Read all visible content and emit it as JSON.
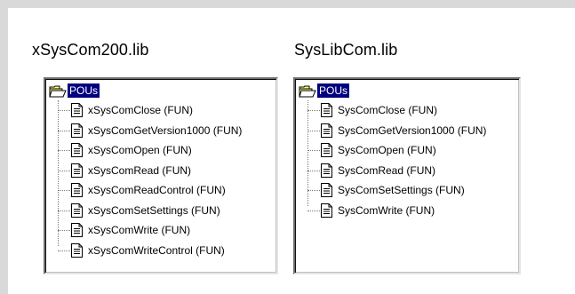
{
  "left_library": {
    "title": "xSysCom200.lib",
    "root_label": "POUs",
    "items": [
      "xSysComClose (FUN)",
      "xSysComGetVersion1000 (FUN)",
      "xSysComOpen (FUN)",
      "xSysComRead (FUN)",
      "xSysComReadControl (FUN)",
      "xSysComSetSettings (FUN)",
      "xSysComWrite (FUN)",
      "xSysComWriteControl (FUN)"
    ]
  },
  "right_library": {
    "title": "SysLibCom.lib",
    "root_label": "POUs",
    "items": [
      "SysComClose (FUN)",
      "SysComGetVersion1000 (FUN)",
      "SysComOpen (FUN)",
      "SysComRead (FUN)",
      "SysComSetSettings (FUN)",
      "SysComWrite (FUN)"
    ]
  },
  "colors": {
    "selection_background": "#00007f",
    "selection_text": "#ffffff",
    "frame": "#d9d9d9",
    "folder": "#ffff80"
  },
  "icons": {
    "root": "open-folder-icon",
    "item": "document-icon"
  }
}
